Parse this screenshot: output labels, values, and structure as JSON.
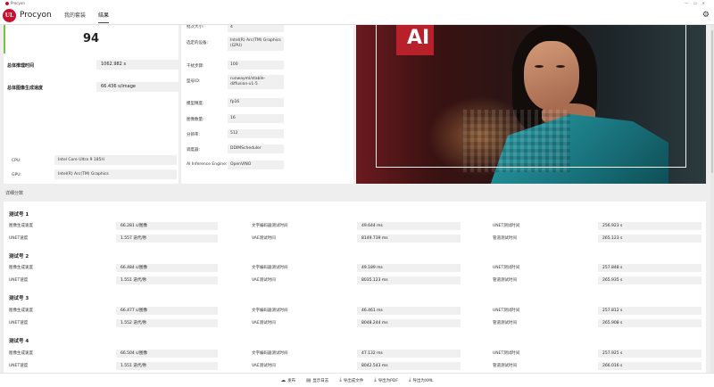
{
  "window": {
    "title": "Procyon"
  },
  "app": {
    "brand": "Procyon",
    "nav": [
      {
        "label": "我的套装"
      },
      {
        "label": "结果",
        "active": true
      }
    ]
  },
  "summary": {
    "score": "94",
    "total_time_label": "总体推理时间",
    "total_time_value": "1062.982 s",
    "speed_label": "总体图像生成速度",
    "speed_value": "66.436 s/image",
    "cpu_label": "CPU:",
    "cpu_value": "Intel Core Ultra 9 185H",
    "gpu_label": "GPU:",
    "gpu_value": "Intel(R) Arc(TM) Graphics"
  },
  "params": [
    {
      "label": "批次大小:",
      "value": "4"
    },
    {
      "label": "选定的设备:",
      "value": "Intel(R) Arc(TM) Graphics (GPU)"
    },
    {
      "label": "干扰步骤:",
      "value": "100"
    },
    {
      "label": "型号ID:",
      "value": "runwayml/stable-diffusion-v1-5"
    },
    {
      "label": "模型精度:",
      "value": "fp16"
    },
    {
      "label": "图像数量:",
      "value": "16"
    },
    {
      "label": "分辨率:",
      "value": "512"
    },
    {
      "label": "调度器:",
      "value": "DDIMScheduler"
    },
    {
      "label": "AI Inference Engine:",
      "value": "OpenVINO"
    }
  ],
  "image": {
    "logo_text": "AI"
  },
  "details": {
    "section_label": "详细分数",
    "runs": [
      {
        "title": "测试号 1",
        "rows": [
          [
            {
              "label": "图像生成速度",
              "value": "66.281 s/图像"
            },
            {
              "label": "文字编码器测试时间",
              "value": "49.644 ms"
            },
            {
              "label": "UNET测试时间",
              "value": "256.923 s"
            }
          ],
          [
            {
              "label": "UNET速度",
              "value": "1.557 迭代/秒"
            },
            {
              "label": "VAE测试时间",
              "value": "8149.739 ms"
            },
            {
              "label": "管道测试时间",
              "value": "265.123 s"
            }
          ]
        ]
      },
      {
        "title": "测试号 2",
        "rows": [
          [
            {
              "label": "图像生成速度",
              "value": "66.484 s/图像"
            },
            {
              "label": "文字编码器测试时间",
              "value": "49.189 ms"
            },
            {
              "label": "UNET测试时间",
              "value": "257.848 s"
            }
          ],
          [
            {
              "label": "UNET速度",
              "value": "1.551 迭代/秒"
            },
            {
              "label": "VAE测试时间",
              "value": "8035.123 ms"
            },
            {
              "label": "管道测试时间",
              "value": "265.935 s"
            }
          ]
        ]
      },
      {
        "title": "测试号 3",
        "rows": [
          [
            {
              "label": "图像生成速度",
              "value": "66.477 s/图像"
            },
            {
              "label": "文字编码器测试时间",
              "value": "46.461 ms"
            },
            {
              "label": "UNET测试时间",
              "value": "257.812 s"
            }
          ],
          [
            {
              "label": "UNET速度",
              "value": "1.552 迭代/秒"
            },
            {
              "label": "VAE测试时间",
              "value": "8048.244 ms"
            },
            {
              "label": "管道测试时间",
              "value": "265.908 s"
            }
          ]
        ]
      },
      {
        "title": "测试号 4",
        "rows": [
          [
            {
              "label": "图像生成速度",
              "value": "66.504 s/图像"
            },
            {
              "label": "文字编码器测试时间",
              "value": "47.132 ms"
            },
            {
              "label": "UNET测试时间",
              "value": "257.925 s"
            }
          ],
          [
            {
              "label": "UNET速度",
              "value": "1.551 迭代/秒"
            },
            {
              "label": "VAE测试时间",
              "value": "8042.543 ms"
            },
            {
              "label": "管道测试时间",
              "value": "266.016 s"
            }
          ]
        ]
      }
    ]
  },
  "footer": [
    {
      "label": "发布",
      "icon": "cloud-upload-icon",
      "glyph": "☁"
    },
    {
      "label": "显示日志",
      "icon": "log-icon",
      "glyph": "▤"
    },
    {
      "label": "导出成文件",
      "icon": "export-file-icon",
      "glyph": "⤓"
    },
    {
      "label": "导出为PDF",
      "icon": "export-pdf-icon",
      "glyph": "⤓"
    },
    {
      "label": "导出为XML",
      "icon": "export-xml-icon",
      "glyph": "⤓"
    }
  ],
  "colors": {
    "brand": "#c8102e",
    "accent": "#7ac143"
  }
}
